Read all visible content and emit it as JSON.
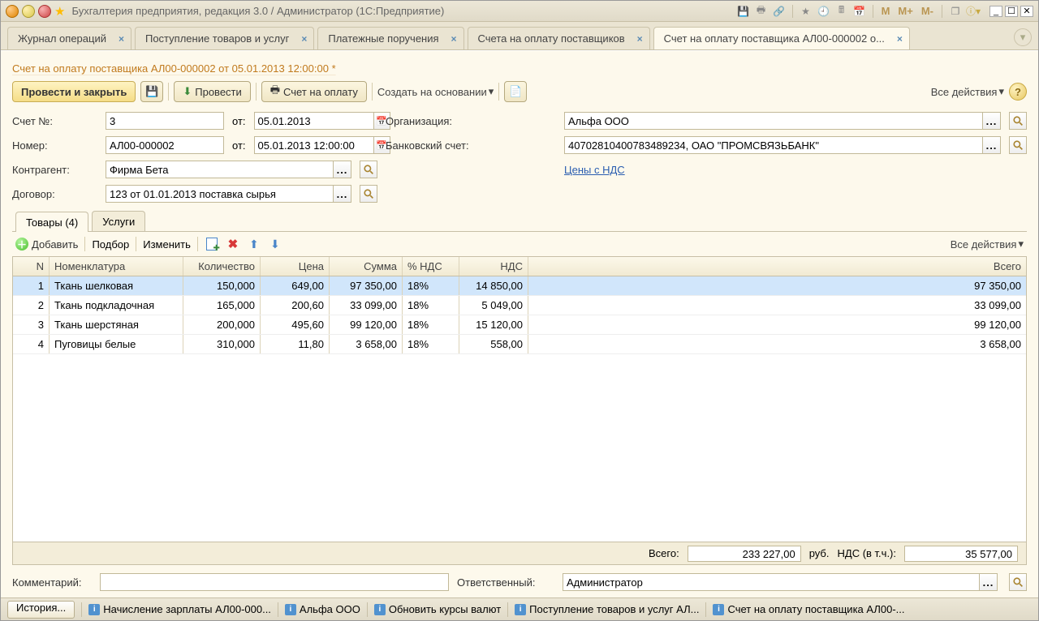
{
  "window": {
    "title": "Бухгалтерия предприятия, редакция 3.0 / Администратор  (1С:Предприятие)"
  },
  "top_tabs": [
    {
      "label": "Журнал операций"
    },
    {
      "label": "Поступление товаров и услуг"
    },
    {
      "label": "Платежные поручения"
    },
    {
      "label": "Счета на оплату поставщиков"
    },
    {
      "label": "Счет на оплату поставщика АЛ00-000002 о..."
    }
  ],
  "doc_title": "Счет на оплату поставщика АЛ00-000002 от 05.01.2013 12:00:00 *",
  "toolbar": {
    "post_close": "Провести и закрыть",
    "post": "Провести",
    "print": "Счет на оплату",
    "create_based": "Создать на основании",
    "all_actions": "Все действия"
  },
  "labels": {
    "schet_no": "Счет №:",
    "ot": "от:",
    "number": "Номер:",
    "kontragent": "Контрагент:",
    "dogovor": "Договор:",
    "organization": "Организация:",
    "bank_account": "Банковский счет:",
    "prices_with_vat": "Цены с НДС",
    "comment": "Комментарий:",
    "responsible": "Ответственный:",
    "total": "Всего:",
    "rub": "руб.",
    "nds_incl": "НДС (в т.ч.):"
  },
  "fields": {
    "schet_no": "3",
    "schet_date": "05.01.2013",
    "number": "АЛ00-000002",
    "number_date": "05.01.2013 12:00:00",
    "kontragent": "Фирма Бета",
    "dogovor": "123 от 01.01.2013 поставка сырья",
    "organization": "Альфа ООО",
    "bank_account": "40702810400783489234, ОАО \"ПРОМСВЯЗЬБАНК\"",
    "comment": "",
    "responsible": "Администратор"
  },
  "inner_tabs": {
    "goods": "Товары (4)",
    "services": "Услуги"
  },
  "table_toolbar": {
    "add": "Добавить",
    "pick": "Подбор",
    "edit": "Изменить",
    "all_actions": "Все действия"
  },
  "columns": {
    "n": "N",
    "nom": "Номенклатура",
    "qty": "Количество",
    "price": "Цена",
    "sum": "Сумма",
    "ndsp": "% НДС",
    "nds": "НДС",
    "total": "Всего"
  },
  "rows": [
    {
      "n": "1",
      "nom": "Ткань шелковая",
      "qty": "150,000",
      "price": "649,00",
      "sum": "97 350,00",
      "ndsp": "18%",
      "nds": "14 850,00",
      "total": "97 350,00"
    },
    {
      "n": "2",
      "nom": "Ткань подкладочная",
      "qty": "165,000",
      "price": "200,60",
      "sum": "33 099,00",
      "ndsp": "18%",
      "nds": "5 049,00",
      "total": "33 099,00"
    },
    {
      "n": "3",
      "nom": "Ткань шерстяная",
      "qty": "200,000",
      "price": "495,60",
      "sum": "99 120,00",
      "ndsp": "18%",
      "nds": "15 120,00",
      "total": "99 120,00"
    },
    {
      "n": "4",
      "nom": "Пуговицы белые",
      "qty": "310,000",
      "price": "11,80",
      "sum": "3 658,00",
      "ndsp": "18%",
      "nds": "558,00",
      "total": "3 658,00"
    }
  ],
  "totals": {
    "sum": "233 227,00",
    "nds": "35 577,00"
  },
  "taskbar": {
    "history": "История...",
    "items": [
      "Начисление зарплаты АЛ00-000...",
      "Альфа ООО",
      "Обновить курсы валют",
      "Поступление товаров и услуг АЛ...",
      "Счет на оплату поставщика АЛ00-..."
    ]
  }
}
